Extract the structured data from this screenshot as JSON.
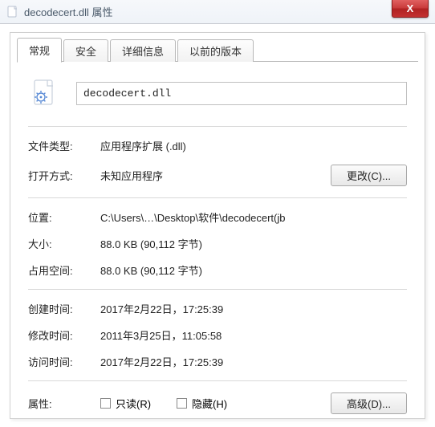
{
  "window": {
    "title": "decodecert.dll 属性",
    "close_label": "X"
  },
  "tabs": [
    {
      "label": "常规",
      "active": true
    },
    {
      "label": "安全",
      "active": false
    },
    {
      "label": "详细信息",
      "active": false
    },
    {
      "label": "以前的版本",
      "active": false
    }
  ],
  "general": {
    "filename": "decodecert.dll",
    "rows": {
      "filetype_label": "文件类型:",
      "filetype_value": "应用程序扩展 (.dll)",
      "openswith_label": "打开方式:",
      "openswith_value": "未知应用程序",
      "change_button": "更改(C)...",
      "location_label": "位置:",
      "location_value": "C:\\Users\\…\\Desktop\\软件\\decodecert(jb",
      "size_label": "大小:",
      "size_value": "88.0 KB (90,112 字节)",
      "diskspace_label": "占用空间:",
      "diskspace_value": "88.0 KB (90,112 字节)",
      "created_label": "创建时间:",
      "created_value": "2017年2月22日，17:25:39",
      "modified_label": "修改时间:",
      "modified_value": "2011年3月25日，11:05:58",
      "accessed_label": "访问时间:",
      "accessed_value": "2017年2月22日，17:25:39",
      "attributes_label": "属性:",
      "readonly_label": "只读(R)",
      "hidden_label": "隐藏(H)",
      "advanced_button": "高级(D)..."
    }
  }
}
